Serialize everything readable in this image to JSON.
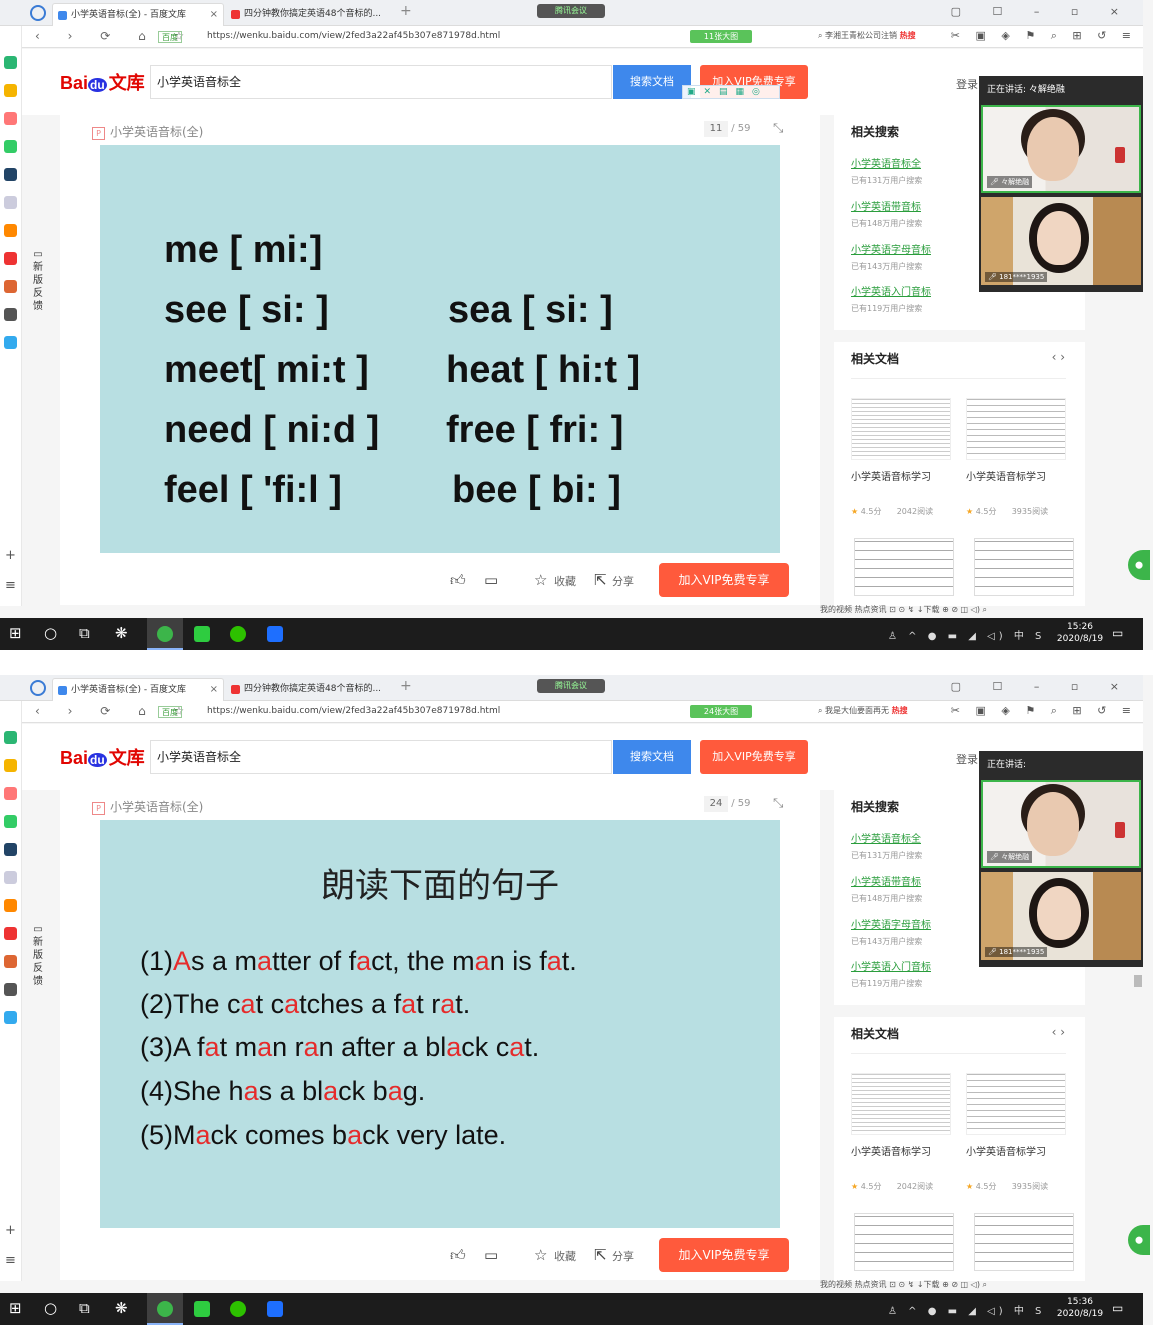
{
  "shots": [
    {
      "tabs": [
        {
          "label": "小学英语音标(全) - 百度文库"
        },
        {
          "label": "四分钟教你搞定英语48个音标的..."
        }
      ],
      "meeting_pill": "腾讯会议",
      "address": {
        "secure": "百度",
        "url": "https://wenku.baidu.com/view/2fed3a22af45b307e871978d.html",
        "badge": "11张大图",
        "search": "李湘王青松公司注销",
        "hot": "热搜"
      },
      "header": {
        "search_value": "小学英语音标全",
        "search_button": "搜索文档",
        "vip_button": "加入VIP免费专享",
        "login": "登录"
      },
      "doc": {
        "title": "小学英语音标(全)",
        "page": "11",
        "total": "/ 59"
      },
      "meeting": {
        "speaking": "正在讲话: 々解绝融",
        "name1": "々解绝融",
        "name2": "181****1935"
      },
      "clock": {
        "time": "15:26",
        "date": "2020/8/19"
      }
    },
    {
      "tabs": [
        {
          "label": "小学英语音标(全) - 百度文库"
        },
        {
          "label": "四分钟教你搞定英语48个音标的..."
        }
      ],
      "meeting_pill": "腾讯会议",
      "address": {
        "secure": "百度",
        "url": "https://wenku.baidu.com/view/2fed3a22af45b307e871978d.html",
        "badge": "24张大图",
        "search": "我是大仙要面再无",
        "hot": "热搜"
      },
      "header": {
        "search_value": "小学英语音标全",
        "search_button": "搜索文档",
        "vip_button": "加入VIP免费专享",
        "login": "登录"
      },
      "doc": {
        "title": "小学英语音标(全)",
        "page": "24",
        "total": "/ 59"
      },
      "meeting": {
        "speaking": "正在讲话:",
        "name1": "々解绝融",
        "name2": "181****1935"
      },
      "clock": {
        "time": "15:36",
        "date": "2020/8/19"
      }
    }
  ],
  "logo": {
    "bai": "Bai",
    "du": "du",
    "wk": "文库"
  },
  "feedback": "新版反馈",
  "footer": {
    "collect": "收藏",
    "share": "分享",
    "vip": "加入VIP免费专享"
  },
  "related_search": {
    "title": "相关搜索",
    "items": [
      {
        "link": "小学英语音标全",
        "count": "已有131万用户搜索"
      },
      {
        "link": "小学英语带音标",
        "count": "已有148万用户搜索"
      },
      {
        "link": "小学英语字母音标",
        "count": "已有143万用户搜索"
      },
      {
        "link": "小学英语入门音标",
        "count": "已有119万用户搜索"
      }
    ]
  },
  "related_docs": {
    "title": "相关文档",
    "items": [
      {
        "name": "小学英语音标学习",
        "rating": "4.5分",
        "reads": "2042阅读"
      },
      {
        "name": "小学英语音标学习",
        "rating": "4.5分",
        "reads": "3935阅读"
      }
    ]
  },
  "statusbar": "我的视频  热点资讯  ⊡  ⊙  ↯  ↓下载  ⊕  ⊘  ◫  ◁)  ⌕",
  "slide1": {
    "lines": [
      {
        "left": "me  [ mi:]",
        "right": ""
      },
      {
        "left": "see  [ si: ]",
        "right": "sea  [ si: ]"
      },
      {
        "left": "meet[ mi:t ]",
        "right": "heat  [ hi:t ]"
      },
      {
        "left": "need [ ni:d ]",
        "right": "free  [ fri: ]"
      },
      {
        "left": "feel  [ 'fi:l ]",
        "right": "bee [ bi: ]"
      }
    ]
  },
  "slide2": {
    "title": "朗读下面的句子",
    "sentences": [
      [
        [
          "(1)",
          0
        ],
        [
          "A",
          1
        ],
        [
          "s a m",
          0
        ],
        [
          "a",
          1
        ],
        [
          "tter of f",
          0
        ],
        [
          "a",
          1
        ],
        [
          "ct, the m",
          0
        ],
        [
          "a",
          1
        ],
        [
          "n is f",
          0
        ],
        [
          "a",
          1
        ],
        [
          "t.",
          0
        ]
      ],
      [
        [
          "(2)The c",
          0
        ],
        [
          "a",
          1
        ],
        [
          "t c",
          0
        ],
        [
          "a",
          1
        ],
        [
          "tches a f",
          0
        ],
        [
          "a",
          1
        ],
        [
          "t r",
          0
        ],
        [
          "a",
          1
        ],
        [
          "t.",
          0
        ]
      ],
      [
        [
          "(3)A f",
          0
        ],
        [
          "a",
          1
        ],
        [
          "t m",
          0
        ],
        [
          "a",
          1
        ],
        [
          "n r",
          0
        ],
        [
          "a",
          1
        ],
        [
          "n after a bl",
          0
        ],
        [
          "a",
          1
        ],
        [
          "ck c",
          0
        ],
        [
          "a",
          1
        ],
        [
          "t.",
          0
        ]
      ],
      [
        [
          "(4)She h",
          0
        ],
        [
          "a",
          1
        ],
        [
          "s a bl",
          0
        ],
        [
          "a",
          1
        ],
        [
          "ck b",
          0
        ],
        [
          "a",
          1
        ],
        [
          "g.",
          0
        ]
      ],
      [
        [
          "(5)M",
          0
        ],
        [
          "a",
          1
        ],
        [
          "ck comes b",
          0
        ],
        [
          "a",
          1
        ],
        [
          "ck very late.",
          0
        ]
      ]
    ]
  },
  "colors": {
    "accent_red": "#ff5a3c",
    "search_blue": "#3e88ec",
    "link_green": "#2a9d3c",
    "slide_bg": "#b8dfe2",
    "vowel_red": "#e52b2b"
  }
}
